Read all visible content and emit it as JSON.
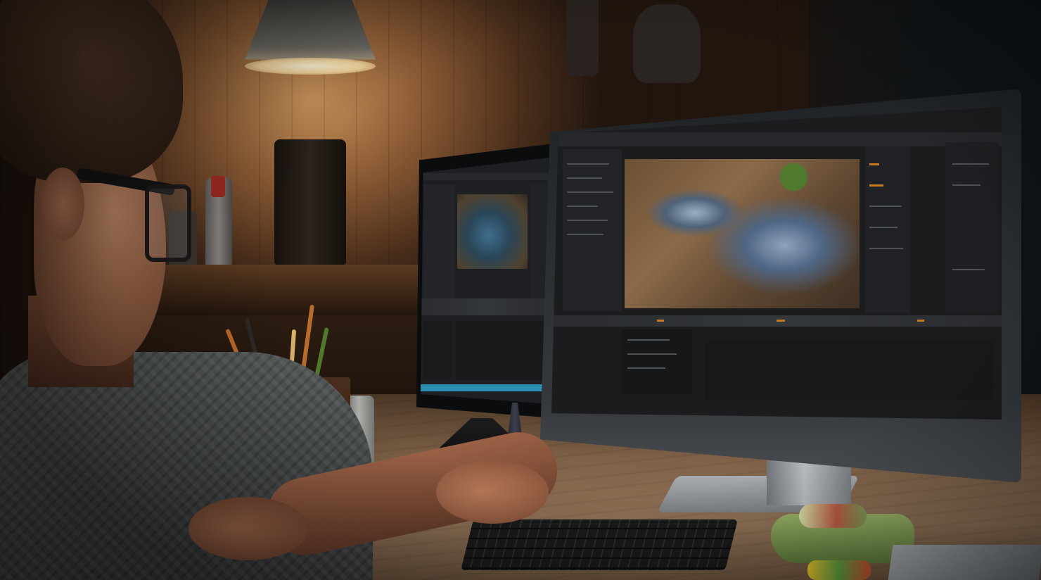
{
  "scene": {
    "colors": {
      "warm_wall": "#8a5a34",
      "lamp_light": "#f3d59c",
      "desk_wood": "#8f7257",
      "screen_dark": "#1b1c1e",
      "ui_accent_orange": "#c77a25",
      "ui_accent_blue": "#2a8fb0"
    },
    "objects": [
      "lamp-icon",
      "monitor-icon",
      "keyboard-icon",
      "mouse-icon",
      "pencil-icon",
      "glasses-icon"
    ]
  }
}
